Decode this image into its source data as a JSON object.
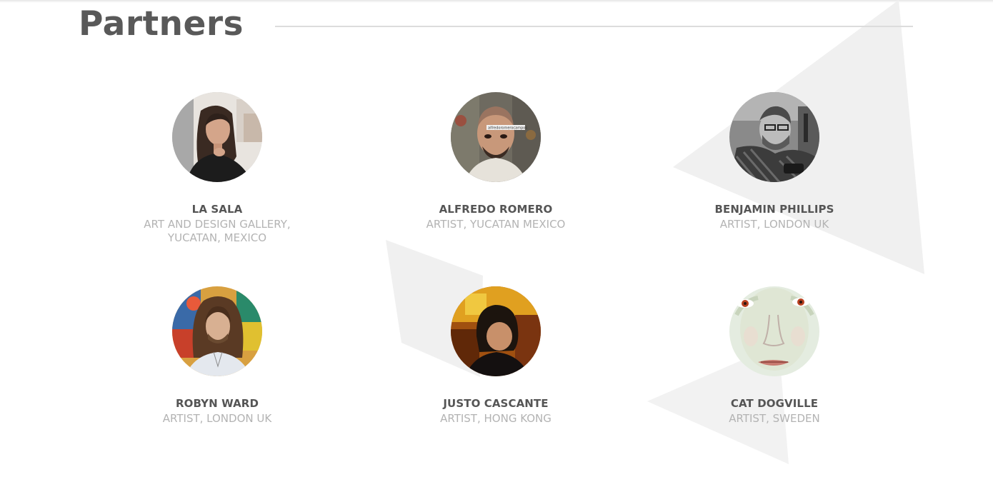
{
  "section": {
    "title": "Partners"
  },
  "partners": [
    {
      "name": "LA SALA",
      "role": "ART AND DESIGN GALLERY, YUCATAN, MEXICO",
      "photo": "portrait-photo"
    },
    {
      "name": "ALFREDO ROMERO",
      "role": "ARTIST, YUCATAN MEXICO",
      "photo": "portrait-photo",
      "photo_caption": "alfredoromerocampos"
    },
    {
      "name": "BENJAMIN PHILLIPS",
      "role": "ARTIST, LONDON UK",
      "photo": "portrait-photo"
    },
    {
      "name": "ROBYN WARD",
      "role": "ARTIST, LONDON UK",
      "photo": "portrait-photo"
    },
    {
      "name": "JUSTO CASCANTE",
      "role": "ARTIST, HONG KONG",
      "photo": "portrait-photo"
    },
    {
      "name": "CAT DOGVILLE",
      "role": "ARTIST, SWEDEN",
      "photo": "painted-portrait"
    }
  ],
  "colors": {
    "title": "#595959",
    "name": "#555555",
    "role": "#b3b3b3",
    "rule": "#dcdcdc",
    "shapes": "#eeeeee"
  }
}
